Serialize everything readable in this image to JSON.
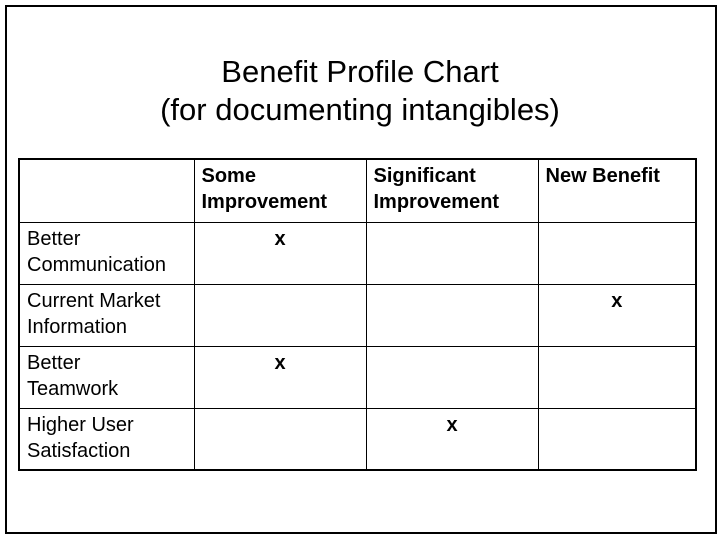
{
  "title": {
    "line1": "Benefit Profile Chart",
    "line2": "(for documenting intangibles)"
  },
  "table": {
    "columns": [
      "",
      "Some Improvement",
      "Significant Improvement",
      "New Benefit"
    ],
    "columns_lines": [
      [
        "",
        ""
      ],
      [
        "Some",
        "Improvement"
      ],
      [
        "Significant",
        "Improvement"
      ],
      [
        "New Benefit",
        ""
      ]
    ],
    "rows": [
      {
        "label": "Better Communication",
        "label_lines": [
          "Better",
          "Communication"
        ],
        "cells": [
          "x",
          "",
          ""
        ]
      },
      {
        "label": "Current Market Information",
        "label_lines": [
          "Current Market",
          "Information"
        ],
        "cells": [
          "",
          "",
          "x"
        ]
      },
      {
        "label": "Better Teamwork",
        "label_lines": [
          "Better",
          "Teamwork"
        ],
        "cells": [
          "x",
          "",
          ""
        ]
      },
      {
        "label": "Higher User Satisfaction",
        "label_lines": [
          "Higher User",
          "Satisfaction"
        ],
        "cells": [
          "",
          "x",
          ""
        ]
      }
    ]
  }
}
